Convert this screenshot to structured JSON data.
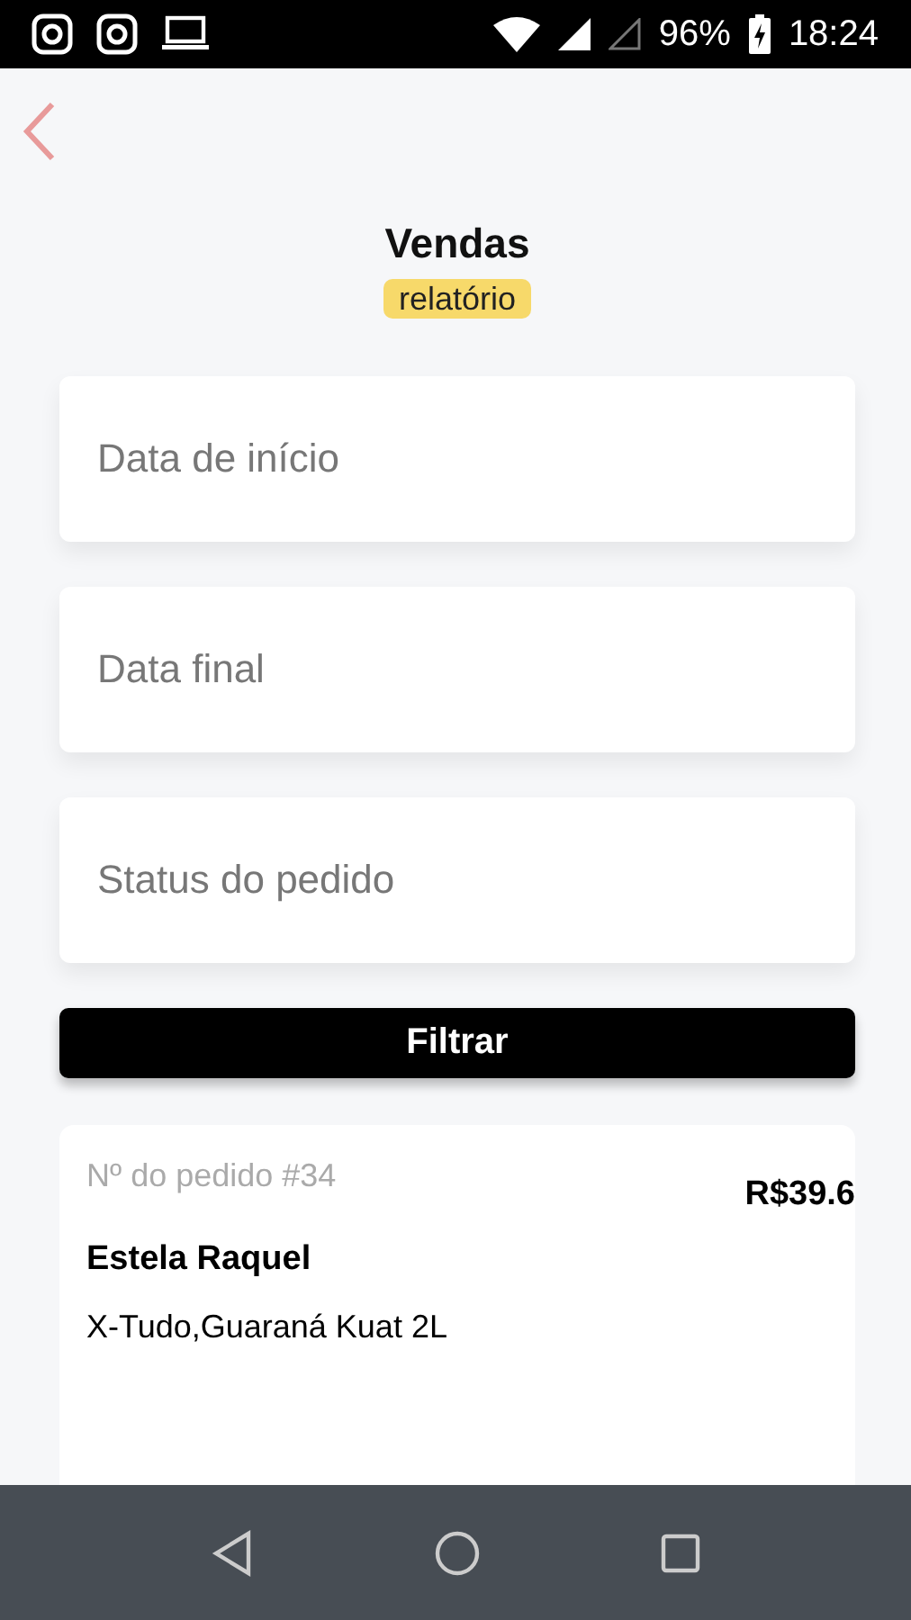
{
  "status_bar": {
    "battery": "96%",
    "time": "18:24"
  },
  "header": {
    "title": "Vendas",
    "badge": "relatório"
  },
  "fields": [
    {
      "placeholder": "Data de início"
    },
    {
      "placeholder": "Data final"
    },
    {
      "placeholder": "Status do pedido"
    }
  ],
  "filter_button": "Filtrar",
  "orders": [
    {
      "number": "Nº do pedido #34",
      "price": "R$39.6",
      "customer": "Estela Raquel",
      "items": "X-Tudo,Guaraná Kuat 2L"
    }
  ]
}
